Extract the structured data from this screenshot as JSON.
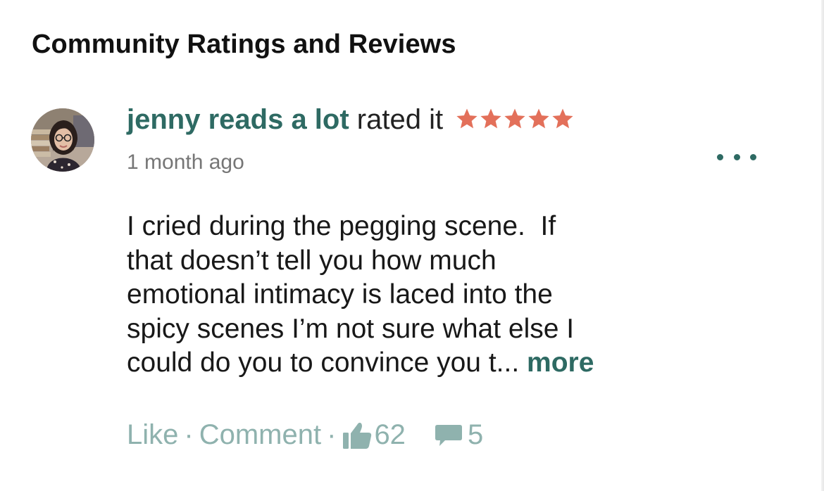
{
  "section": {
    "title": "Community Ratings and Reviews"
  },
  "review": {
    "reviewer_name": "jenny reads a lot",
    "rated_text": "rated it",
    "rating": 5,
    "rating_max": 5,
    "star_color": "#e3705a",
    "timestamp": "1 month ago",
    "body_lines": [
      "I cried during the pegging scene.  If",
      "that doesn’t tell you how much",
      "emotional intimacy is laced into the",
      "spicy scenes I’m not sure what else I",
      "could do you to convince you t... "
    ],
    "more_label": "more",
    "like_label": "Like",
    "separator": "·",
    "comment_label": "Comment",
    "likes_count": "62",
    "comments_count": "5",
    "icons": {
      "menu": "more-horizontal-icon",
      "like": "thumbs-up-icon",
      "comment": "speech-bubble-icon"
    }
  },
  "colors": {
    "accent": "#2e6a63",
    "muted_accent": "#8fb2ae",
    "star": "#e3705a"
  }
}
